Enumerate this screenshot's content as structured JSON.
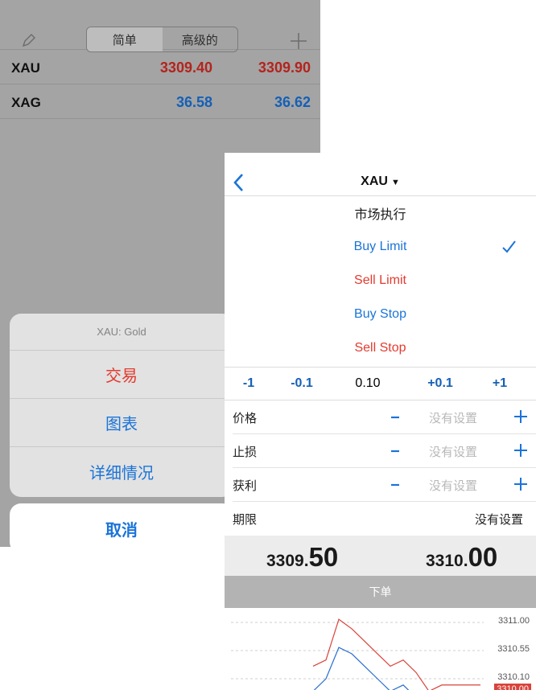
{
  "left": {
    "segments": [
      "简单",
      "高级的"
    ],
    "quotes": [
      {
        "symbol": "XAU",
        "bid": "3309.40",
        "ask": "3309.90",
        "color": "#b3241d"
      },
      {
        "symbol": "XAG",
        "bid": "36.58",
        "ask": "36.62",
        "color": "#1560b6"
      }
    ],
    "sheet": {
      "header": "XAU: Gold",
      "items": [
        "交易",
        "图表",
        "详细情况"
      ],
      "cancel": "取消"
    }
  },
  "right": {
    "title": "XAU",
    "title_chevron": "▼",
    "order_types": [
      {
        "label": "市场执行",
        "color": "#1a1a1a",
        "checked": false
      },
      {
        "label": "Buy Limit",
        "color": "#1b74d8",
        "checked": true
      },
      {
        "label": "Sell Limit",
        "color": "#e33b2e",
        "checked": false
      },
      {
        "label": "Buy Stop",
        "color": "#1b74d8",
        "checked": false
      },
      {
        "label": "Sell Stop",
        "color": "#e33b2e",
        "checked": false
      }
    ],
    "volume": {
      "dec1": "-1",
      "dec01": "-0.1",
      "value": "0.10",
      "inc01": "+0.1",
      "inc1": "+1"
    },
    "fields": [
      {
        "label": "价格",
        "value": "没有设置"
      },
      {
        "label": "止损",
        "value": "没有设置"
      },
      {
        "label": "获利",
        "value": "没有设置"
      }
    ],
    "expiry": {
      "label": "期限",
      "value": "没有设置"
    },
    "bid": {
      "main": "3309.",
      "big": "50"
    },
    "ask": {
      "main": "3310.",
      "big": "00"
    },
    "place_order": "下单"
  },
  "chart_data": {
    "type": "line",
    "y_ticks": [
      "3311.00",
      "3310.55",
      "3310.10"
    ],
    "last_price": "3310.00",
    "series": [
      {
        "values": [
          3310.3,
          3310.4,
          3311.05,
          3310.9,
          3310.7,
          3310.5,
          3310.3,
          3310.4,
          3310.2,
          3309.9,
          3310.0,
          3310.0,
          3310.0,
          3310.0
        ],
        "color": "#d9433a"
      },
      {
        "values": [
          3309.9,
          3310.1,
          3310.6,
          3310.5,
          3310.3,
          3310.1,
          3309.9,
          3310.0,
          3309.8,
          3309.9,
          3309.9,
          3309.9,
          3309.9,
          3309.9
        ],
        "color": "#2a6fd1"
      }
    ]
  },
  "colors": {
    "buy": "#1b74d8",
    "sell": "#e33b2e",
    "bid_text": "#b3241d",
    "ask_text": "#1560b6"
  }
}
